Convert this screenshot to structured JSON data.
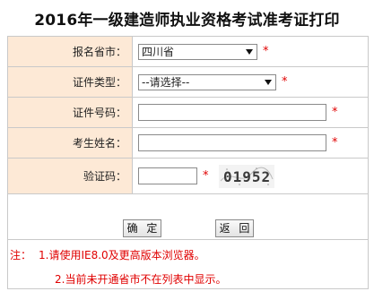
{
  "page": {
    "title": "2016年一级建造师执业资格考试准考证打印"
  },
  "form": {
    "province": {
      "label": "报名省市：",
      "selected": "四川省",
      "required_mark": "*"
    },
    "id_type": {
      "label": "证件类型：",
      "selected": "--请选择--",
      "required_mark": "*"
    },
    "id_number": {
      "label": "证件号码：",
      "value": "",
      "required_mark": "*"
    },
    "name": {
      "label": "考生姓名：",
      "value": "",
      "required_mark": "*"
    },
    "captcha": {
      "label": "验证码：",
      "value": "",
      "required_mark": "*",
      "image_text": "01952"
    }
  },
  "buttons": {
    "confirm_label": "确 定",
    "back_label": "返 回"
  },
  "notes": {
    "prefix": "注：",
    "line1": "1.请使用IE8.0及更高版本浏览器。",
    "line2": "2.当前未开通省市不在列表中显示。"
  },
  "colors": {
    "label_bg": "#fde9d6",
    "required": "#e00000",
    "border": "#c9c9c9"
  }
}
